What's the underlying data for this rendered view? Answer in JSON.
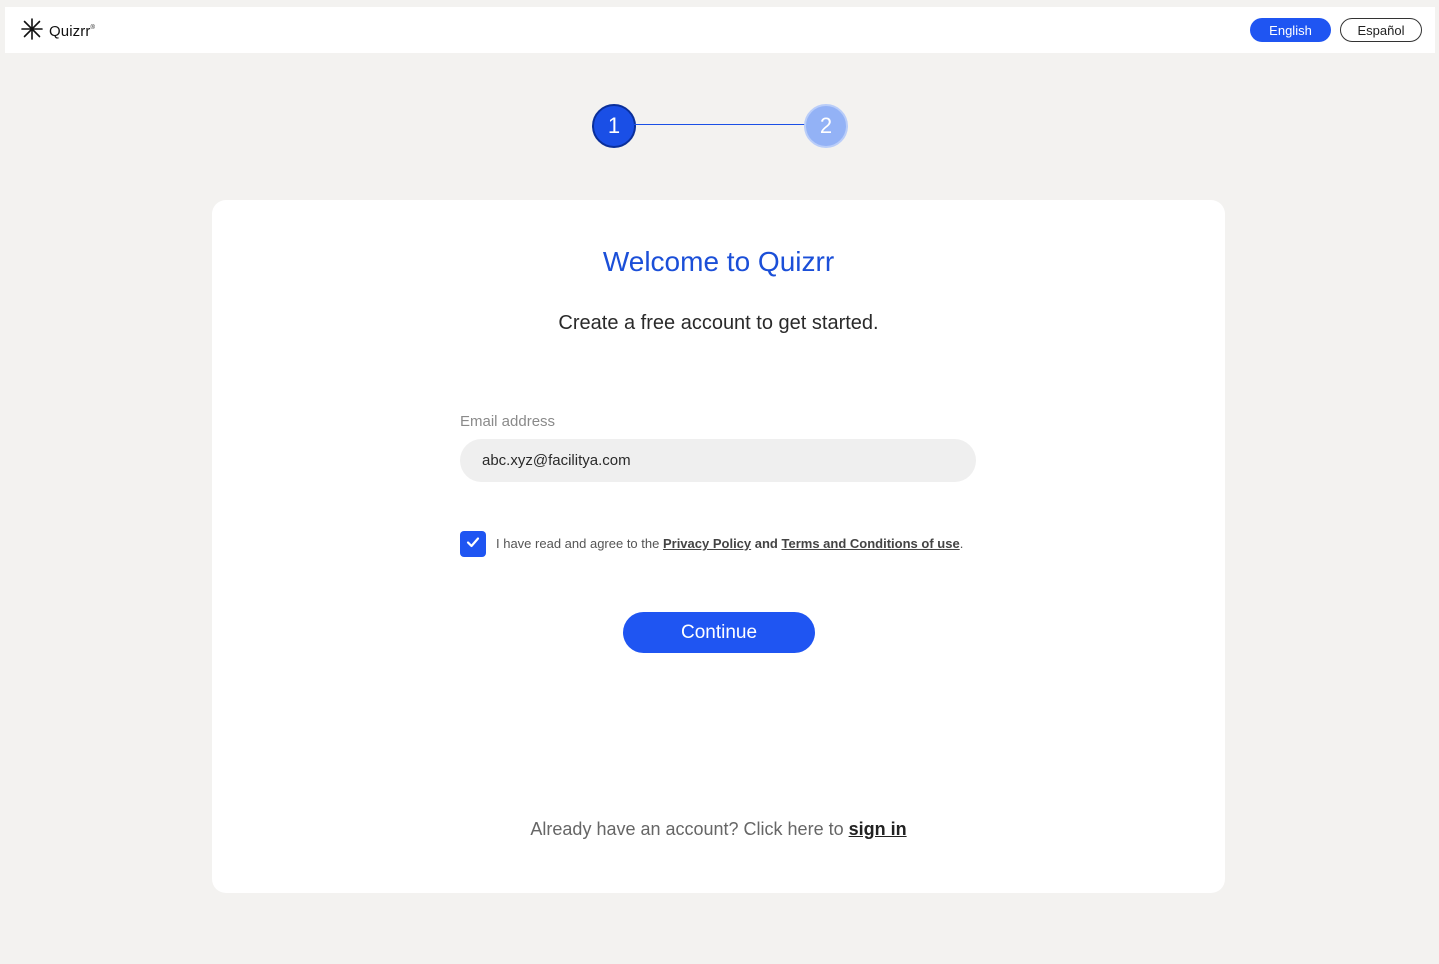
{
  "header": {
    "brand": "Quizrr",
    "brand_mark": "®",
    "logo_icon": "asterisk-star-icon",
    "languages": [
      {
        "label": "English",
        "active": true
      },
      {
        "label": "Español",
        "active": false
      }
    ]
  },
  "stepper": {
    "steps": [
      "1",
      "2"
    ],
    "current": 1,
    "colors": {
      "active": "#1a4fe6",
      "inactive": "#93b2f6"
    }
  },
  "card": {
    "title": "Welcome to Quizrr",
    "subtitle": "Create a free account to get started.",
    "email": {
      "label": "Email address",
      "value": "abc.xyz@facilitya.com"
    },
    "agreement": {
      "checked": true,
      "prefix": "I have read and agree to the ",
      "privacy_link": "Privacy Policy",
      "and": "and",
      "terms_link": "Terms and Conditions of use",
      "suffix": "."
    },
    "continue_label": "Continue",
    "signin_prompt": "Already have an account? Click here to ",
    "signin_link": "sign in"
  },
  "colors": {
    "accent": "#1f55f2",
    "title": "#1b4fd8",
    "page_background": "#f3f2f0"
  }
}
